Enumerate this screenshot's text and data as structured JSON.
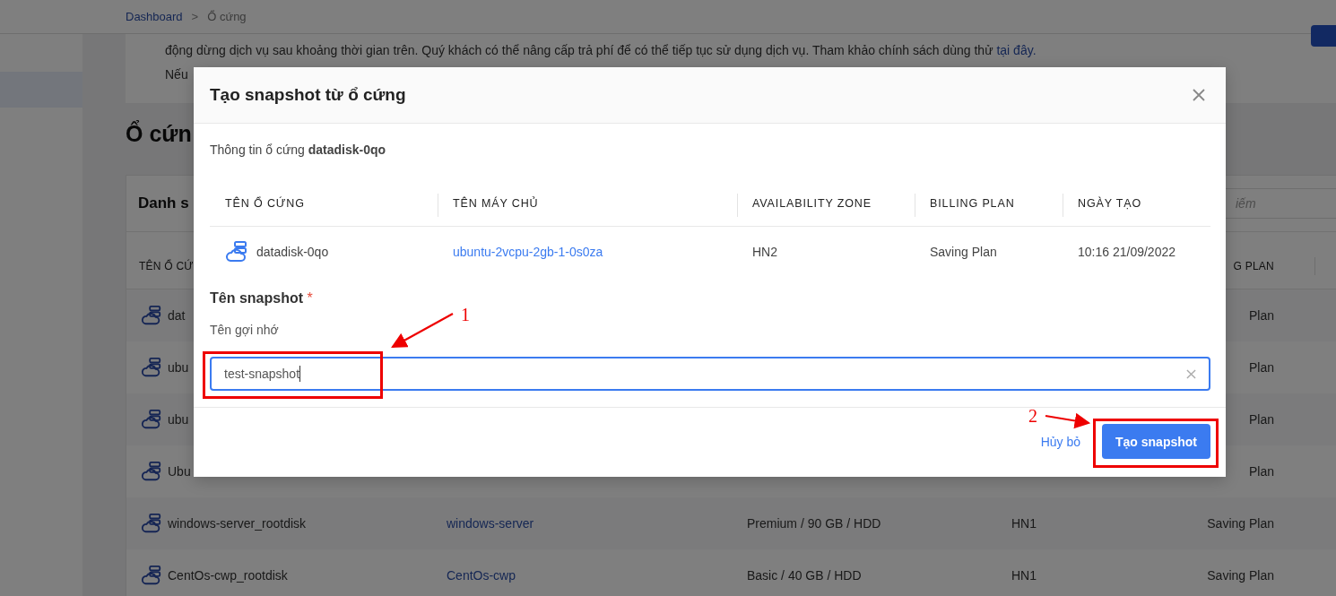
{
  "breadcrumb": [
    {
      "label": "Dashboard",
      "kind": "link"
    },
    {
      "label": ">",
      "kind": "separator"
    },
    {
      "label": "Ổ cứng",
      "kind": "current"
    }
  ],
  "notice": {
    "text": "động dừng dịch vụ sau khoảng thời gian trên. Quý khách có thể nâng cấp trả phí để có thể tiếp tục sử dụng dịch vụ. Tham khảo chính sách dùng thử",
    "link": "tại đây.",
    "second_line": "Nếu"
  },
  "page_heading": "Ổ cứn",
  "disk_list": {
    "title": "Danh s",
    "search": {
      "placeholder": "iếm"
    },
    "first_column": "TÊN Ổ CỨ",
    "last_column": "G PLAN",
    "rows": [
      {
        "name": "dat",
        "billing": "Plan"
      },
      {
        "name": "ubu",
        "billing": "Plan"
      },
      {
        "name": "ubu",
        "billing": "Plan"
      },
      {
        "name": "Ubu",
        "billing": "Plan"
      },
      {
        "name": "windows-server_rootdisk",
        "server": "windows-server",
        "size": "Premium / 90 GB / HDD",
        "zone": "HN1",
        "billing": "Saving Plan"
      },
      {
        "name": "CentOs-cwp_rootdisk",
        "server": "CentOs-cwp",
        "size": "Basic / 40 GB / HDD",
        "zone": "HN1",
        "billing": "Saving Plan"
      }
    ]
  },
  "modal": {
    "title": "Tạo snapshot từ ổ cứng",
    "info": "Thông tin ổ cứng **datadisk-0qo**",
    "columns": [
      "TÊN Ổ CỨNG",
      "TÊN MÁY CHỦ",
      "AVAILABILITY ZONE",
      "BILLING PLAN",
      "NGÀY TẠO"
    ],
    "disk": {
      "name": "datadisk-0qo",
      "server": "ubuntu-2vcpu-2gb-1-0s0za",
      "zone": "HN2",
      "billing": "Saving Plan",
      "created": "10:16 21/09/2022"
    },
    "field_title": "Tên snapshot",
    "required_mark": "*",
    "field_label": "Tên gợi nhớ",
    "field_value": "test-snapshot",
    "cancel": "Hủy bỏ",
    "submit": "Tạo snapshot"
  },
  "annotations": [
    {
      "label": "1"
    },
    {
      "label": "2"
    }
  ]
}
